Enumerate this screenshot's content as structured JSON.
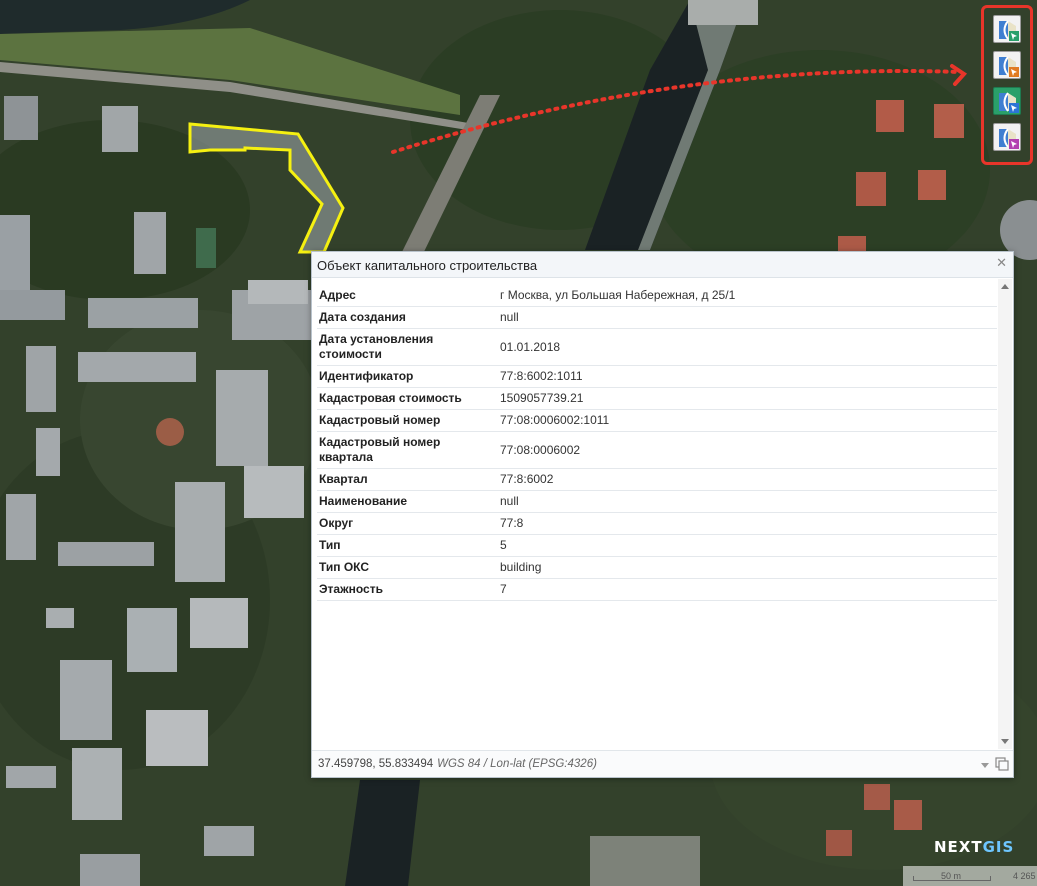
{
  "map": {
    "highlight_color": "#f5f011",
    "arrow_color": "#e8352a"
  },
  "toolbar": {
    "tools": [
      {
        "icon": "identify-green-cursor-icon",
        "accent": "#2aa06a",
        "active": false
      },
      {
        "icon": "identify-orange-cursor-icon",
        "accent": "#e07b22",
        "active": false
      },
      {
        "icon": "identify-blue-cursor-icon",
        "accent": "#2c74d6",
        "active": true
      },
      {
        "icon": "identify-purple-cursor-icon",
        "accent": "#b23fb0",
        "active": false
      }
    ]
  },
  "popup": {
    "title": "Объект капитального строительства",
    "close_icon": "close-icon",
    "rows": [
      {
        "key": "Адрес",
        "value": "г Москва, ул Большая Набережная, д 25/1"
      },
      {
        "key": "Дата создания",
        "value": "null"
      },
      {
        "key": "Дата установления стоимости",
        "value": "01.01.2018"
      },
      {
        "key": "Идентификатор",
        "value": "77:8:6002:1011"
      },
      {
        "key": "Кадастровая стоимость",
        "value": "1509057739.21"
      },
      {
        "key": "Кадастровый номер",
        "value": "77:08:0006002:1011"
      },
      {
        "key": "Кадастровый номер квартала",
        "value": "77:08:0006002"
      },
      {
        "key": "Квартал",
        "value": "77:8:6002"
      },
      {
        "key": "Наименование",
        "value": "null"
      },
      {
        "key": "Округ",
        "value": "77:8"
      },
      {
        "key": "Тип",
        "value": "5"
      },
      {
        "key": "Тип ОКС",
        "value": "building"
      },
      {
        "key": "Этажность",
        "value": "7"
      }
    ],
    "footer": {
      "coordinates": "37.459798, 55.833494",
      "crs": "WGS 84 / Lon-lat (EPSG:4326)"
    }
  },
  "logo": {
    "part1": "NEXT",
    "part2": "GIS"
  },
  "scale": {
    "label": "50 m",
    "extra": "4 265"
  }
}
